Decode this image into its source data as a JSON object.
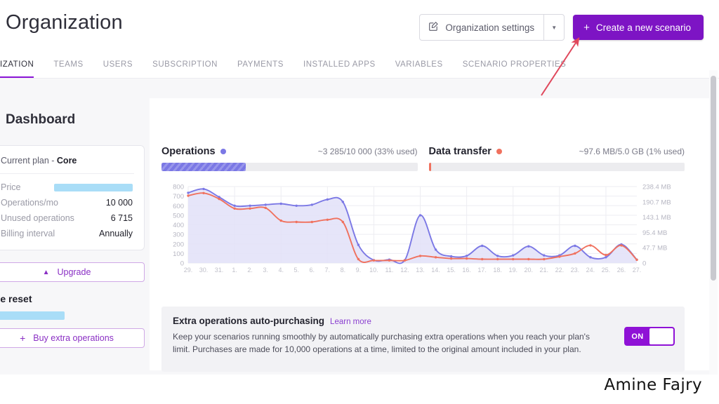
{
  "header": {
    "title": "Organization",
    "org_settings_label": "Organization settings",
    "org_settings_icon": "edit-square-icon",
    "dropdown_icon": "chevron-down-icon",
    "create_button_label": "Create a new scenario",
    "create_button_icon": "plus-icon",
    "accent_purple": "#7d14c4"
  },
  "tabs": [
    {
      "label": "IZATION",
      "active": true
    },
    {
      "label": "TEAMS",
      "active": false
    },
    {
      "label": "USERS",
      "active": false
    },
    {
      "label": "SUBSCRIPTION",
      "active": false
    },
    {
      "label": "PAYMENTS",
      "active": false
    },
    {
      "label": "INSTALLED APPS",
      "active": false
    },
    {
      "label": "VARIABLES",
      "active": false
    },
    {
      "label": "SCENARIO PROPERTIES",
      "active": false
    }
  ],
  "dashboard": {
    "title": "Dashboard"
  },
  "plan_card": {
    "heading_prefix": "Current plan - ",
    "plan_name": "Core",
    "rows": [
      {
        "label": "Price",
        "value": "",
        "redacted": true,
        "redact_width": 112
      },
      {
        "label": "Operations/mo",
        "value": "10 000",
        "redacted": false
      },
      {
        "label": "Unused operations",
        "value": "6 715",
        "redacted": false
      },
      {
        "label": "Billing interval",
        "value": "Annually",
        "redacted": false
      }
    ],
    "upgrade_label": "Upgrade",
    "upgrade_icon": "chevron-up-icon",
    "usage_reset_title": "age reset",
    "buy_extra_label": "Buy extra operations",
    "buy_extra_icon": "plus-icon"
  },
  "metrics": [
    {
      "name": "Operations",
      "dot_color": "#7b78e5",
      "value_text": "~3 285/10 000 (33% used)",
      "percent": 33
    },
    {
      "name": "Data transfer",
      "dot_color": "#f0715e",
      "value_text": "~97.6 MB/5.0 GB (1% used)",
      "percent": 1
    }
  ],
  "extra_ops": {
    "title": "Extra operations auto-purchasing",
    "learn_more": "Learn more",
    "description": "Keep your scenarios running smoothly by automatically purchasing extra operations when you reach your plan's limit. Purchases are made for 10,000 operations at a time, limited to the original amount included in your plan.",
    "toggle_label": "ON",
    "toggle_on": true
  },
  "watermark": "Amine Fajry",
  "chart_data": {
    "type": "area",
    "title": "",
    "xlabel": "",
    "ylabel": "",
    "grid": true,
    "legend_position": "none",
    "categories": [
      "29.",
      "30.",
      "31.",
      "1.",
      "2.",
      "3.",
      "4.",
      "5.",
      "6.",
      "7.",
      "8.",
      "9.",
      "10.",
      "11.",
      "12.",
      "13.",
      "14.",
      "15.",
      "16.",
      "17.",
      "18.",
      "19.",
      "20.",
      "21.",
      "22.",
      "23.",
      "24.",
      "25.",
      "26.",
      "27."
    ],
    "left_axis": {
      "label": "Operations",
      "ticks": [
        0,
        100,
        200,
        300,
        400,
        500,
        600,
        700,
        800
      ],
      "ylim": [
        0,
        800
      ]
    },
    "right_axis": {
      "label": "Data transfer",
      "ticks": [
        "0",
        "47.7 MB",
        "95.4 MB",
        "143.1 MB",
        "190.7 MB",
        "238.4 MB"
      ],
      "tick_values": [
        0,
        47.7,
        95.4,
        143.1,
        190.7,
        238.4
      ],
      "ylim": [
        0,
        238.4
      ]
    },
    "series": [
      {
        "name": "Operations",
        "color": "#7b78e5",
        "fill": "#e2e1f8",
        "axis": "left",
        "values": [
          735,
          775,
          690,
          600,
          600,
          610,
          620,
          600,
          610,
          665,
          640,
          190,
          30,
          35,
          30,
          500,
          140,
          70,
          75,
          180,
          75,
          80,
          175,
          80,
          80,
          180,
          60,
          60,
          195,
          35
        ]
      },
      {
        "name": "Data transfer",
        "color": "#f0715e",
        "axis": "right",
        "values": [
          210,
          218,
          200,
          170,
          170,
          172,
          132,
          128,
          128,
          135,
          128,
          12,
          8,
          8,
          8,
          22,
          18,
          14,
          14,
          12,
          12,
          12,
          12,
          12,
          20,
          30,
          55,
          25,
          55,
          10
        ]
      }
    ]
  }
}
